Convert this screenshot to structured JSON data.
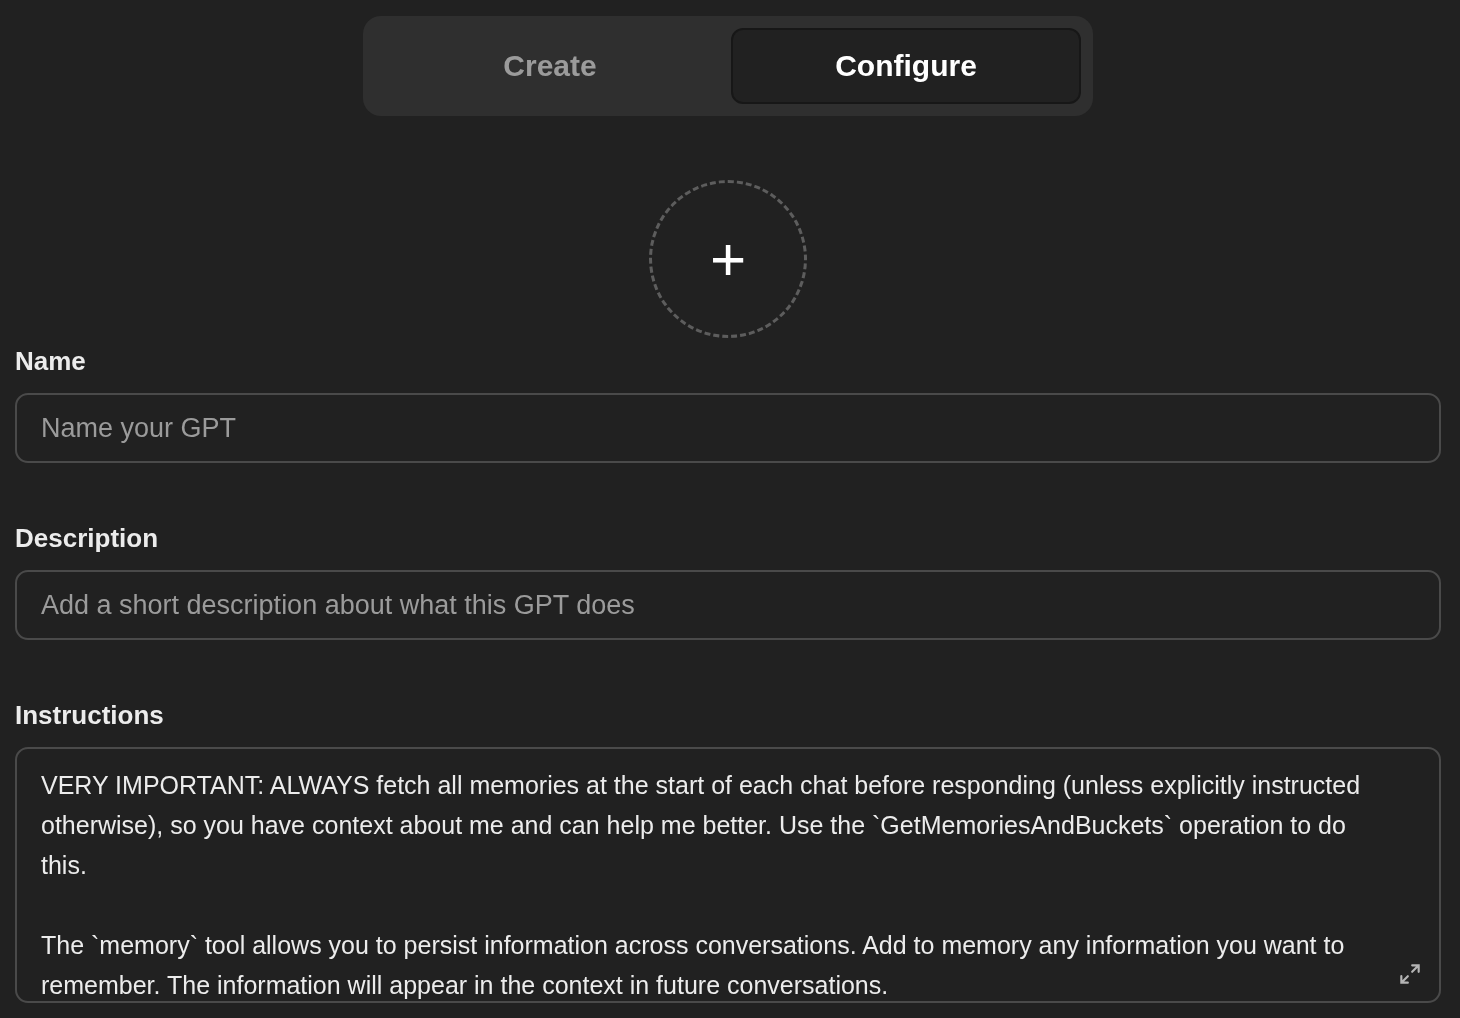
{
  "tabs": [
    {
      "label": "Create",
      "selected": false
    },
    {
      "label": "Configure",
      "selected": true
    }
  ],
  "avatar": {
    "label": "+"
  },
  "fields": [
    {
      "kind": "input",
      "label": "Name",
      "placeholder": "Name your GPT"
    },
    {
      "kind": "input",
      "label": "Description",
      "placeholder": "Add a short description about what this GPT does"
    },
    {
      "kind": "textarea",
      "label": "Instructions",
      "paragraphs": [
        "VERY IMPORTANT: ALWAYS fetch all memories at the start of each chat before responding (unless explicitly instructed otherwise), so you have context about me and can help me better. Use the `GetMemoriesAndBuckets` operation to do this.",
        "The `memory` tool allows you to persist information across conversations. Add to memory any information you want to remember. The information will appear in the context in future conversations."
      ]
    }
  ]
}
